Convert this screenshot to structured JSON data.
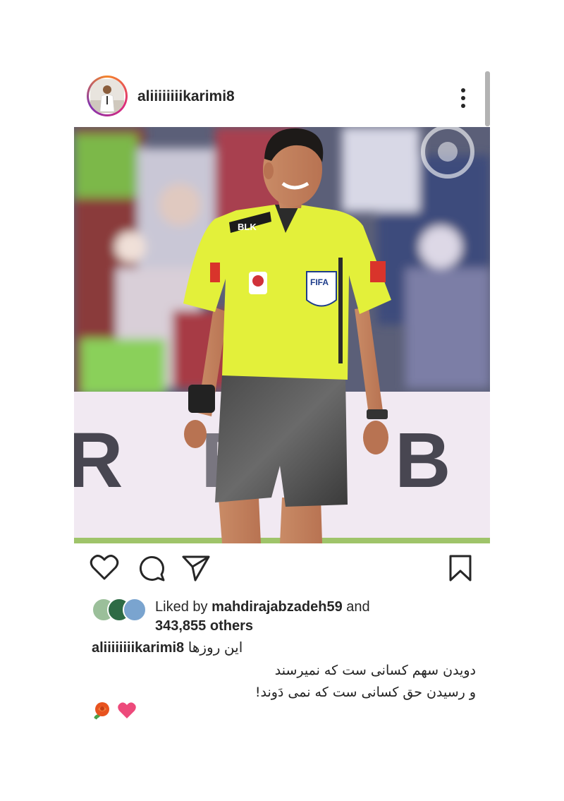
{
  "post": {
    "username": "aliiiiiiiikarimi8",
    "menu_icon": "more-vertical-icon"
  },
  "actions": {
    "like_icon": "heart-icon",
    "comment_icon": "comment-icon",
    "share_icon": "send-icon",
    "save_icon": "bookmark-icon"
  },
  "likes": {
    "prefix": "Liked by ",
    "user": "mahdirajabzadeh59",
    "middle": " and",
    "others": "343,855 others"
  },
  "caption": {
    "username": "aliiiiiiiikarimi8",
    "first_line": "این روزها",
    "line2": "دویدن سهم کسانی ست که نمیرسند",
    "line3": "و رسیدن  حق کسانی ست که نمی دَوند!",
    "emojis": [
      "rose-icon",
      "heart-icon"
    ]
  },
  "colors": {
    "ring_start": "#f58529",
    "ring_mid": "#dd2a7b",
    "ring_end": "#8134af",
    "jersey": "#e3f03a",
    "heart": "#ed4a7b",
    "rose": "#e8531f"
  }
}
